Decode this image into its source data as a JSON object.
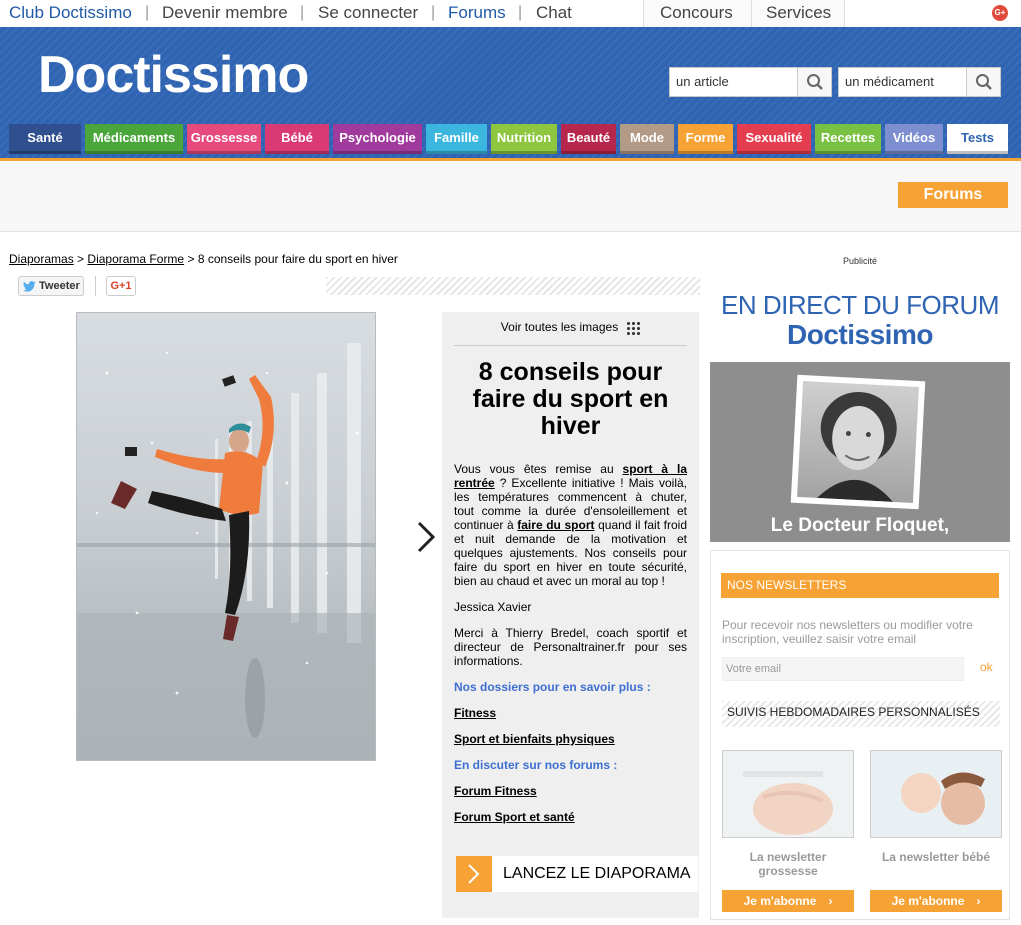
{
  "top_bar": {
    "links": [
      "Club Doctissimo",
      "Devenir membre",
      "Se connecter",
      "Forums",
      "Chat"
    ],
    "right_tabs": [
      "Concours",
      "Services"
    ],
    "gplus_label": "G+"
  },
  "header": {
    "logo": "Doctissimo",
    "search_article": "un article",
    "search_medicament": "un médicament"
  },
  "nav": {
    "items": [
      {
        "label": "Santé",
        "color": "#2f4f8f"
      },
      {
        "label": "Médicaments",
        "color": "#4aa63b"
      },
      {
        "label": "Grossesse",
        "color": "#e64a7d"
      },
      {
        "label": "Bébé",
        "color": "#d93a74"
      },
      {
        "label": "Psychologie",
        "color": "#a03a9c"
      },
      {
        "label": "Famille",
        "color": "#3bb7df"
      },
      {
        "label": "Nutrition",
        "color": "#8ec63f"
      },
      {
        "label": "Beauté",
        "color": "#b7264d"
      },
      {
        "label": "Mode",
        "color": "#b39a86"
      },
      {
        "label": "Forme",
        "color": "#f7a234"
      },
      {
        "label": "Sexualité",
        "color": "#e43d4f"
      },
      {
        "label": "Recettes",
        "color": "#79c142"
      },
      {
        "label": "Vidéos",
        "color": "#7d8fd0"
      },
      {
        "label": "Tests",
        "color": "#ffffff"
      }
    ]
  },
  "forums_button": "Forums",
  "breadcrumb": {
    "l1": "Diaporamas",
    "sep": ">",
    "l2": "Diaporama Forme",
    "current": "8 conseils pour faire du sport en hiver"
  },
  "share": {
    "tweet": "Tweeter",
    "gplus": "G+1"
  },
  "article": {
    "voir_label": "Voir toutes les images",
    "title": "8 conseils pour faire du sport en hiver",
    "intro_1": "Vous vous êtes remise au ",
    "intro_link_1": "sport à la rentrée",
    "intro_2": " ? Excellente initiative ! Mais voilà, les températures commencent à chuter, tout comme la durée d'ensoleillement et continuer à ",
    "intro_link_2": "faire du sport",
    "intro_3": " quand il fait froid et nuit demande de la motivation et quelques ajustements. Nos conseils pour faire du sport en hiver en toute sécurité, bien au chaud et avec un moral au top !",
    "author": "Jessica Xavier",
    "thanks": "Merci à Thierry Bredel, coach sportif et directeur de Personaltrainer.fr pour ses informations.",
    "dossiers_heading": "Nos dossiers pour en savoir plus :",
    "dossier_links": [
      "Fitness",
      "Sport et bienfaits physiques"
    ],
    "forums_heading": "En discuter sur nos forums :",
    "forum_links": [
      "Forum Fitness",
      "Forum Sport et santé"
    ],
    "lancez": "LANCEZ LE DIAPORAMA"
  },
  "sidebar": {
    "publicite": "Publicité",
    "direct_line1": "EN DIRECT DU FORUM",
    "direct_line2": "Doctissimo",
    "doctor_name": "Le Docteur Floquet,",
    "newsletters": {
      "heading": "NOS NEWSLETTERS",
      "text": "Pour recevoir nos newsletters ou modifier votre inscription, veuillez saisir votre email",
      "email_placeholder": "Votre email",
      "ok": "ok",
      "suivis": "SUIVIS HEBDOMADAIRES PERSONNALISÉS",
      "items": [
        {
          "label": "La newsletter grossesse",
          "button": "Je m'abonne"
        },
        {
          "label": "La newsletter bébé",
          "button": "Je m'abonne"
        }
      ]
    }
  }
}
